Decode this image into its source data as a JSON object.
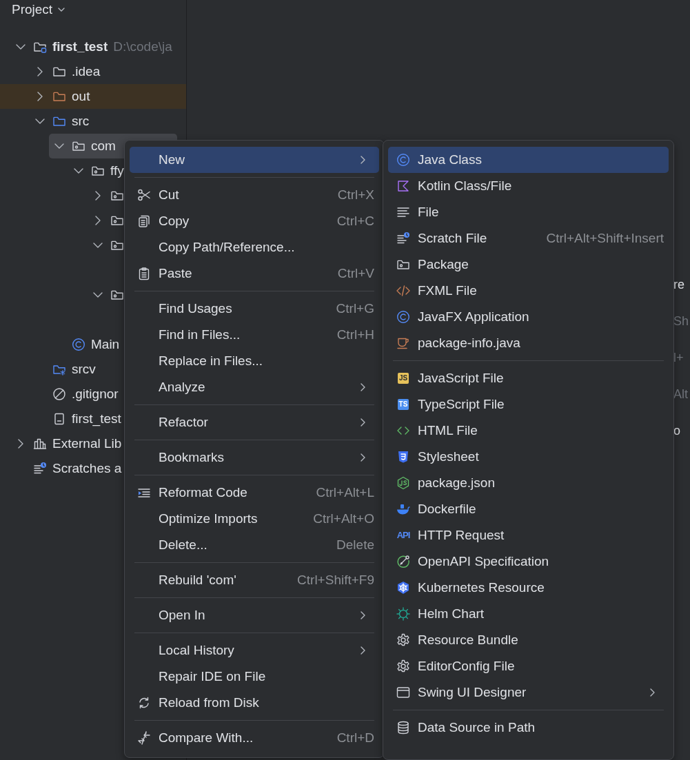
{
  "project_panel": {
    "title": "Project",
    "tree": [
      {
        "kind": "project",
        "label": "first_test",
        "detail": "D:\\code\\ja",
        "expanded": true,
        "selected": false,
        "children": [
          {
            "kind": "folder",
            "label": ".idea",
            "expanded": false,
            "selected": false
          },
          {
            "kind": "excluded",
            "label": "out",
            "expanded": false,
            "selected": false
          },
          {
            "kind": "source",
            "label": "src",
            "expanded": true,
            "selected": false,
            "children": [
              {
                "kind": "package",
                "label": "com",
                "expanded": true,
                "selected": true,
                "children": [
                  {
                    "kind": "package",
                    "label": "ffy",
                    "expanded": true,
                    "selected": false,
                    "children": [
                      {
                        "kind": "package",
                        "expanded": false,
                        "selected": false
                      },
                      {
                        "kind": "package",
                        "expanded": false,
                        "selected": false
                      },
                      {
                        "kind": "package",
                        "expanded": true,
                        "selected": false
                      },
                      {
                        "kind": "package",
                        "expanded": true,
                        "selected": false
                      }
                    ]
                  }
                ]
              },
              {
                "kind": "class",
                "label": "Main",
                "selected": false
              }
            ]
          },
          {
            "kind": "resource",
            "label": "srcv",
            "selected": false
          },
          {
            "kind": "ignore",
            "label": ".gitignor",
            "selected": false
          },
          {
            "kind": "file",
            "label": "first_test",
            "selected": false
          }
        ]
      },
      {
        "kind": "library",
        "label": "External Lib",
        "expanded": false,
        "selected": false
      },
      {
        "kind": "scratches",
        "label": "Scratches a",
        "selected": false
      }
    ]
  },
  "editor": {
    "fragments": [
      {
        "text": "re",
        "dim": false
      },
      {
        "text": "Sh",
        "dim": true
      },
      {
        "text": "l+",
        "dim": true
      },
      {
        "text": "Alt",
        "dim": true
      },
      {
        "text": "o",
        "dim": false
      }
    ]
  },
  "context_menu": {
    "groups": [
      [
        {
          "label": "New",
          "submenu": true,
          "selected": true
        }
      ],
      [
        {
          "label": "Cut",
          "shortcut": "Ctrl+X",
          "selected": false
        },
        {
          "label": "Copy",
          "shortcut": "Ctrl+C",
          "selected": false
        },
        {
          "label": "Copy Path/Reference...",
          "selected": false
        },
        {
          "label": "Paste",
          "shortcut": "Ctrl+V",
          "selected": false
        }
      ],
      [
        {
          "label": "Find Usages",
          "shortcut": "Ctrl+G",
          "selected": false
        },
        {
          "label": "Find in Files...",
          "shortcut": "Ctrl+H",
          "selected": false
        },
        {
          "label": "Replace in Files...",
          "selected": false
        },
        {
          "label": "Analyze",
          "submenu": true,
          "selected": false
        }
      ],
      [
        {
          "label": "Refactor",
          "submenu": true,
          "selected": false
        }
      ],
      [
        {
          "label": "Bookmarks",
          "submenu": true,
          "selected": false
        }
      ],
      [
        {
          "label": "Reformat Code",
          "shortcut": "Ctrl+Alt+L",
          "selected": false
        },
        {
          "label": "Optimize Imports",
          "shortcut": "Ctrl+Alt+O",
          "selected": false
        },
        {
          "label": "Delete...",
          "shortcut": "Delete",
          "selected": false
        }
      ],
      [
        {
          "label": "Rebuild 'com'",
          "shortcut": "Ctrl+Shift+F9",
          "selected": false
        }
      ],
      [
        {
          "label": "Open In",
          "submenu": true,
          "selected": false
        }
      ],
      [
        {
          "label": "Local History",
          "submenu": true,
          "selected": false
        },
        {
          "label": "Repair IDE on File",
          "selected": false
        },
        {
          "label": "Reload from Disk",
          "selected": false
        }
      ],
      [
        {
          "label": "Compare With...",
          "shortcut": "Ctrl+D",
          "selected": false
        }
      ]
    ]
  },
  "new_submenu": {
    "groups": [
      [
        {
          "label": "Java Class",
          "selected": true
        },
        {
          "label": "Kotlin Class/File",
          "selected": false
        },
        {
          "label": "File",
          "selected": false
        },
        {
          "label": "Scratch File",
          "shortcut": "Ctrl+Alt+Shift+Insert",
          "selected": false
        },
        {
          "label": "Package",
          "selected": false
        },
        {
          "label": "FXML File",
          "selected": false
        },
        {
          "label": "JavaFX Application",
          "selected": false
        },
        {
          "label": "package-info.java",
          "selected": false
        }
      ],
      [
        {
          "label": "JavaScript File",
          "badge": "JS",
          "selected": false
        },
        {
          "label": "TypeScript File",
          "badge": "TS",
          "selected": false
        },
        {
          "label": "HTML File",
          "selected": false
        },
        {
          "label": "Stylesheet",
          "selected": false
        },
        {
          "label": "package.json",
          "selected": false
        },
        {
          "label": "Dockerfile",
          "selected": false
        },
        {
          "label": "HTTP Request",
          "badge": "API",
          "selected": false
        },
        {
          "label": "OpenAPI Specification",
          "selected": false
        },
        {
          "label": "Kubernetes Resource",
          "selected": false
        },
        {
          "label": "Helm Chart",
          "selected": false
        },
        {
          "label": "Resource Bundle",
          "selected": false
        },
        {
          "label": "EditorConfig File",
          "selected": false
        },
        {
          "label": "Swing UI Designer",
          "submenu": true,
          "selected": false
        }
      ],
      [
        {
          "label": "Data Source in Path",
          "selected": false
        }
      ]
    ]
  }
}
